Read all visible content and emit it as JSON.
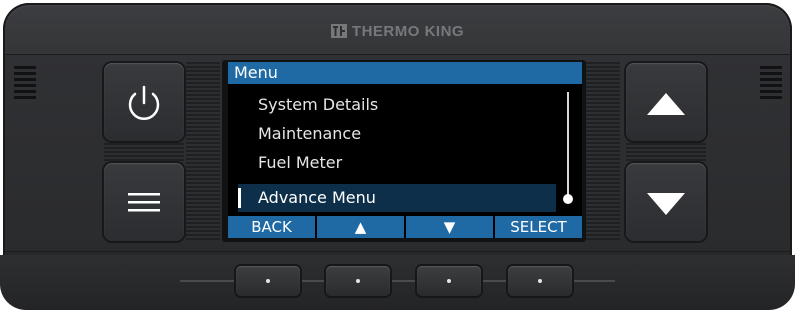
{
  "brand": {
    "name": "THERMO KING",
    "logo_icon": "thermo-king-logo-icon"
  },
  "screen": {
    "title": "Menu",
    "menu_items": [
      {
        "label": "System Details",
        "selected": false
      },
      {
        "label": "Maintenance",
        "selected": false
      },
      {
        "label": "Fuel Meter",
        "selected": false
      },
      {
        "label": "Advance Menu",
        "selected": true
      }
    ],
    "softkeys": [
      {
        "label": "BACK"
      },
      {
        "label": "▲",
        "icon": "up-arrow-icon"
      },
      {
        "label": "▼",
        "icon": "down-arrow-icon"
      },
      {
        "label": "SELECT"
      }
    ]
  },
  "hard_keys": {
    "left": [
      {
        "icon": "power-icon"
      },
      {
        "icon": "menu-icon"
      }
    ],
    "right": [
      {
        "icon": "up-triangle-icon"
      },
      {
        "icon": "down-triangle-icon"
      }
    ],
    "function_keys": 4
  },
  "colors": {
    "accent": "#1f6aa4",
    "selection": "#0d2f4a",
    "bezel": "#2b2c2e"
  }
}
